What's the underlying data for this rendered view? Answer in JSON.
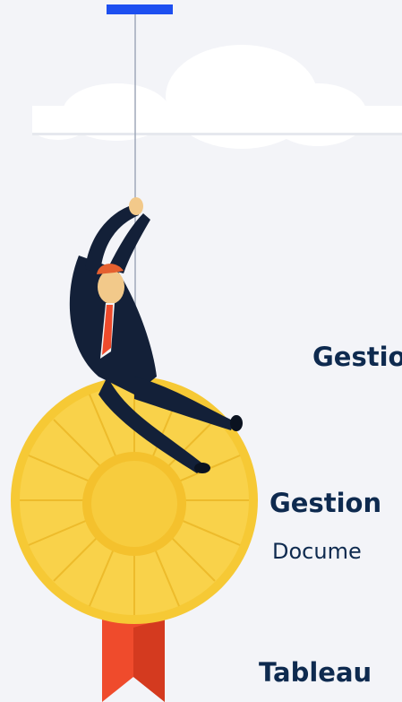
{
  "labels": {
    "item1_title": "Gestio",
    "item2_title": "Gestion",
    "item2_sub": "Docume",
    "item3_title": "Tableau"
  },
  "colors": {
    "background": "#f3f4f8",
    "accent_bar": "#1d4ff0",
    "text": "#0e2a4f",
    "rosette": "#f6c935",
    "ribbon": "#ef4b2c"
  }
}
